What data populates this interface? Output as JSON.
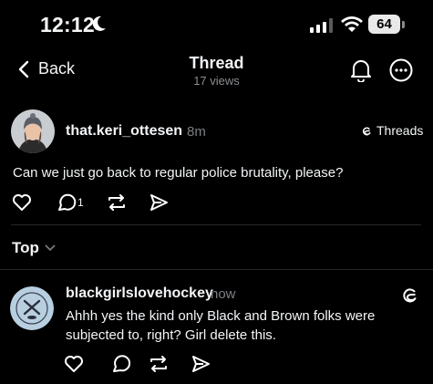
{
  "status_bar": {
    "time": "12:12",
    "battery": "64",
    "icons": [
      "moon-icon",
      "signal-icon",
      "wifi-icon",
      "battery-icon"
    ]
  },
  "header": {
    "back_label": "Back",
    "title": "Thread",
    "views": "17 views"
  },
  "post": {
    "username": "that.keri_ottesen",
    "time": "8m",
    "badge_label": "Threads",
    "text": "Can we just go back to regular police brutality, please?",
    "reply_count": "1"
  },
  "sort": {
    "label": "Top"
  },
  "reply": {
    "username": "blackgirlslovehockey",
    "time": "now",
    "text": "Ahhh yes the kind only Black and Brown folks were subjected to, right? Girl delete this."
  },
  "colors": {
    "background": "#000000",
    "text": "#f3f5f7",
    "secondary_text": "#7c7f84",
    "divider": "#262626"
  }
}
